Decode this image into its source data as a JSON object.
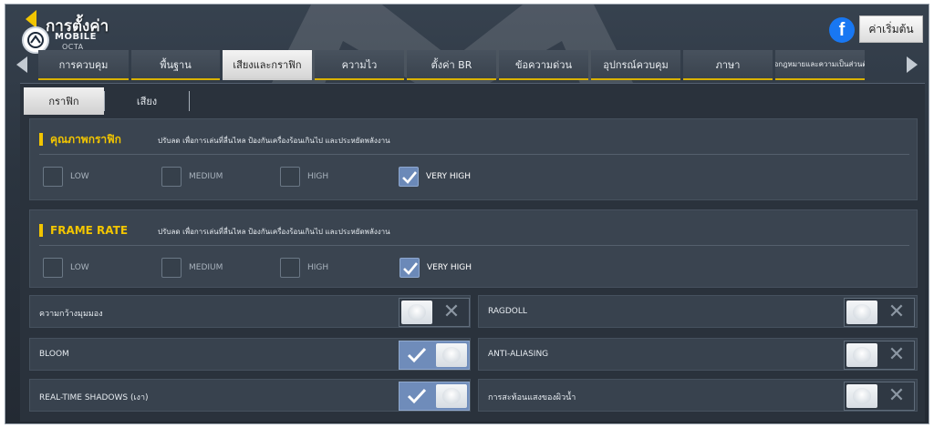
{
  "header": {
    "title": "การตั้งค่า",
    "brand_line1": "MOBILE",
    "brand_line2": "OCTA",
    "reset_label": "ค่าเริ่มต้น"
  },
  "tabs": [
    {
      "label": "การควบคุม"
    },
    {
      "label": "พื้นฐาน"
    },
    {
      "label": "เสียงและกราฟิก"
    },
    {
      "label": "ความไว"
    },
    {
      "label": "ตั้งค่า BR"
    },
    {
      "label": "ข้อความด่วน"
    },
    {
      "label": "อุปกรณ์ควบคุม"
    },
    {
      "label": "ภาษา"
    },
    {
      "label": "ข้อกฎหมายและความเป็นส่วนตัว"
    }
  ],
  "subtabs": [
    {
      "label": "กราฟิก"
    },
    {
      "label": "เสียง"
    }
  ],
  "graphics_quality": {
    "title": "คุณภาพกราฟิก",
    "desc": "ปรับลด เพื่อการเล่นที่ลื่นไหล ป้องกันเครื่องร้อนเกินไป และประหยัดพลังงาน",
    "options": [
      {
        "label": "LOW",
        "checked": false
      },
      {
        "label": "MEDIUM",
        "checked": false
      },
      {
        "label": "HIGH",
        "checked": false
      },
      {
        "label": "VERY HIGH",
        "checked": true
      }
    ]
  },
  "frame_rate": {
    "title": "FRAME RATE",
    "desc": "ปรับลด เพื่อการเล่นที่ลื่นไหล ป้องกันเครื่องร้อนเกินไป และประหยัดพลังงาน",
    "options": [
      {
        "label": "LOW",
        "checked": false
      },
      {
        "label": "MEDIUM",
        "checked": false
      },
      {
        "label": "HIGH",
        "checked": false
      },
      {
        "label": "VERY HIGH",
        "checked": true
      }
    ]
  },
  "toggles_left": [
    {
      "label": "ความกว้างมุมมอง",
      "on": false
    },
    {
      "label": "BLOOM",
      "on": true
    },
    {
      "label": "REAL-TIME SHADOWS (เงา)",
      "on": true
    }
  ],
  "toggles_right": [
    {
      "label": "RAGDOLL",
      "on": false
    },
    {
      "label": "ANTI-ALIASING",
      "on": false
    },
    {
      "label": "การสะท้อนแสงของผิวน้ำ",
      "on": false
    }
  ],
  "colors": {
    "accent_yellow": "#f2c500",
    "checked_blue": "#6b89b8",
    "facebook_blue": "#1877f2"
  }
}
